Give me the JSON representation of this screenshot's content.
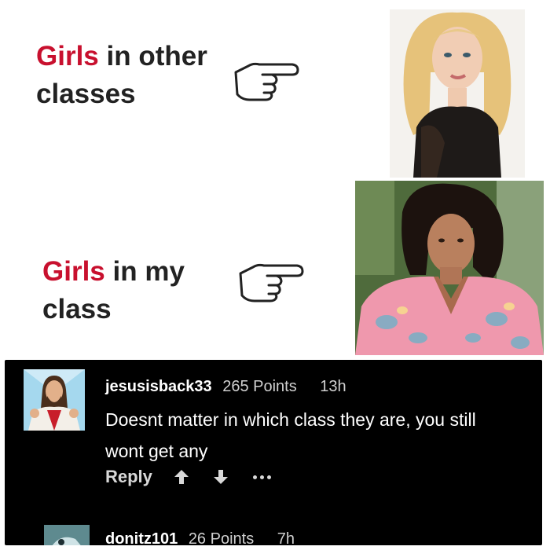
{
  "meme": {
    "top_caption": {
      "highlight": "Girls",
      "rest_line1": " in other",
      "line2": "classes"
    },
    "bottom_caption": {
      "highlight": "Girls",
      "rest_line1": " in my",
      "line2": "class"
    },
    "icons": [
      "pointing-hand-icon",
      "pointing-hand-icon"
    ],
    "highlight_color": "#c8102e"
  },
  "comments": [
    {
      "username": "jesusisback33",
      "points": "265 Points",
      "time": "13h",
      "text": "Doesnt matter in which class they are, you still wont get any",
      "reply_label": "Reply",
      "icons": [
        "upvote-icon",
        "downvote-icon",
        "more-icon"
      ]
    },
    {
      "username": "donitz101",
      "points": "26 Points",
      "time": "7h"
    }
  ]
}
